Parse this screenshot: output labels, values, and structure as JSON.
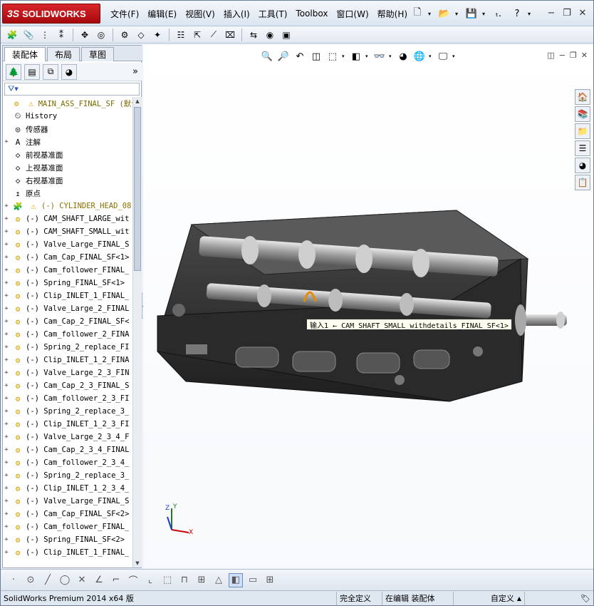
{
  "app": {
    "logo_text": "SOLIDWORKS",
    "logo_mark": "3S"
  },
  "menu": [
    "文件(F)",
    "编辑(E)",
    "视图(V)",
    "插入(I)",
    "工具(T)",
    "Toolbox",
    "窗口(W)",
    "帮助(H)"
  ],
  "quick_access": {
    "help_label": "?",
    "pin_label": "ₜ."
  },
  "feature_manager": {
    "tabs": [
      "装配体",
      "布局",
      "草图"
    ],
    "active_tab": 0,
    "tree": [
      {
        "label": "MAIN_ASS_FINAL_SF  (默认<",
        "root": true,
        "warn": true
      },
      {
        "label": "History",
        "icon": "history-icon"
      },
      {
        "label": "传感器",
        "icon": "sensor-icon"
      },
      {
        "label": "注解",
        "icon": "annotation-icon",
        "exp": "+"
      },
      {
        "label": "前视基准面",
        "icon": "plane-icon"
      },
      {
        "label": "上视基准面",
        "icon": "plane-icon"
      },
      {
        "label": "右视基准面",
        "icon": "plane-icon"
      },
      {
        "label": "原点",
        "icon": "origin-icon"
      },
      {
        "label": "(-) CYLINDER_HEAD_08",
        "icon": "part-icon",
        "warn": true,
        "exp": "+",
        "yel": true
      },
      {
        "label": "(-) CAM_SHAFT_LARGE_wit",
        "exp": "+"
      },
      {
        "label": "(-) CAM_SHAFT_SMALL_wit",
        "exp": "+"
      },
      {
        "label": "(-) Valve_Large_FINAL_S",
        "exp": "+"
      },
      {
        "label": "(-) Cam_Cap_FINAL_SF<1>",
        "exp": "+"
      },
      {
        "label": "(-) Cam_follower_FINAL_",
        "exp": "+"
      },
      {
        "label": "(-) Spring_FINAL_SF<1>",
        "exp": "+"
      },
      {
        "label": "(-) Clip_INLET_1_FINAL_",
        "exp": "+"
      },
      {
        "label": "(-) Valve_Large_2_FINAL",
        "exp": "+"
      },
      {
        "label": "(-) Cam_Cap_2_FINAL_SF<",
        "exp": "+"
      },
      {
        "label": "(-) Cam_follower_2_FINA",
        "exp": "+"
      },
      {
        "label": "(-) Spring_2_replace_FI",
        "exp": "+"
      },
      {
        "label": "(-) Clip_INLET_1_2_FINA",
        "exp": "+"
      },
      {
        "label": "(-) Valve_Large_2_3_FIN",
        "exp": "+"
      },
      {
        "label": "(-) Cam_Cap_2_3_FINAL_S",
        "exp": "+"
      },
      {
        "label": "(-) Cam_follower_2_3_FI",
        "exp": "+"
      },
      {
        "label": "(-) Spring_2_replace_3_",
        "exp": "+"
      },
      {
        "label": "(-) Clip_INLET_1_2_3_FI",
        "exp": "+"
      },
      {
        "label": "(-) Valve_Large_2_3_4_F",
        "exp": "+"
      },
      {
        "label": "(-) Cam_Cap_2_3_4_FINAL",
        "exp": "+"
      },
      {
        "label": "(-) Cam_follower_2_3_4_",
        "exp": "+"
      },
      {
        "label": "(-) Spring_2_replace_3_",
        "exp": "+"
      },
      {
        "label": "(-) Clip_INLET_1_2_3_4_",
        "exp": "+"
      },
      {
        "label": "(-) Valve_Large_FINAL_S",
        "exp": "+"
      },
      {
        "label": "(-) Cam_Cap_FINAL_SF<2>",
        "exp": "+"
      },
      {
        "label": "(-) Cam_follower_FINAL_",
        "exp": "+"
      },
      {
        "label": "(-) Spring_FINAL_SF<2>",
        "exp": "+"
      },
      {
        "label": "(-) Clip_INLET_1_FINAL_",
        "exp": "+"
      }
    ]
  },
  "graphics": {
    "callout_text": "输入1 ← CAM_SHAFT_SMALL_withdetails_FINAL_SF<1>",
    "triad": {
      "x": "X",
      "y": "Y",
      "z": "Z"
    }
  },
  "status_bar": {
    "product": "SolidWorks Premium 2014 x64 版",
    "definition": "完全定义",
    "mode": "在编辑 装配体",
    "units": "自定义"
  },
  "colors": {
    "accent": "#d2a100",
    "logo_red": "#c3161b",
    "model_dark": "#2b2b2b"
  }
}
